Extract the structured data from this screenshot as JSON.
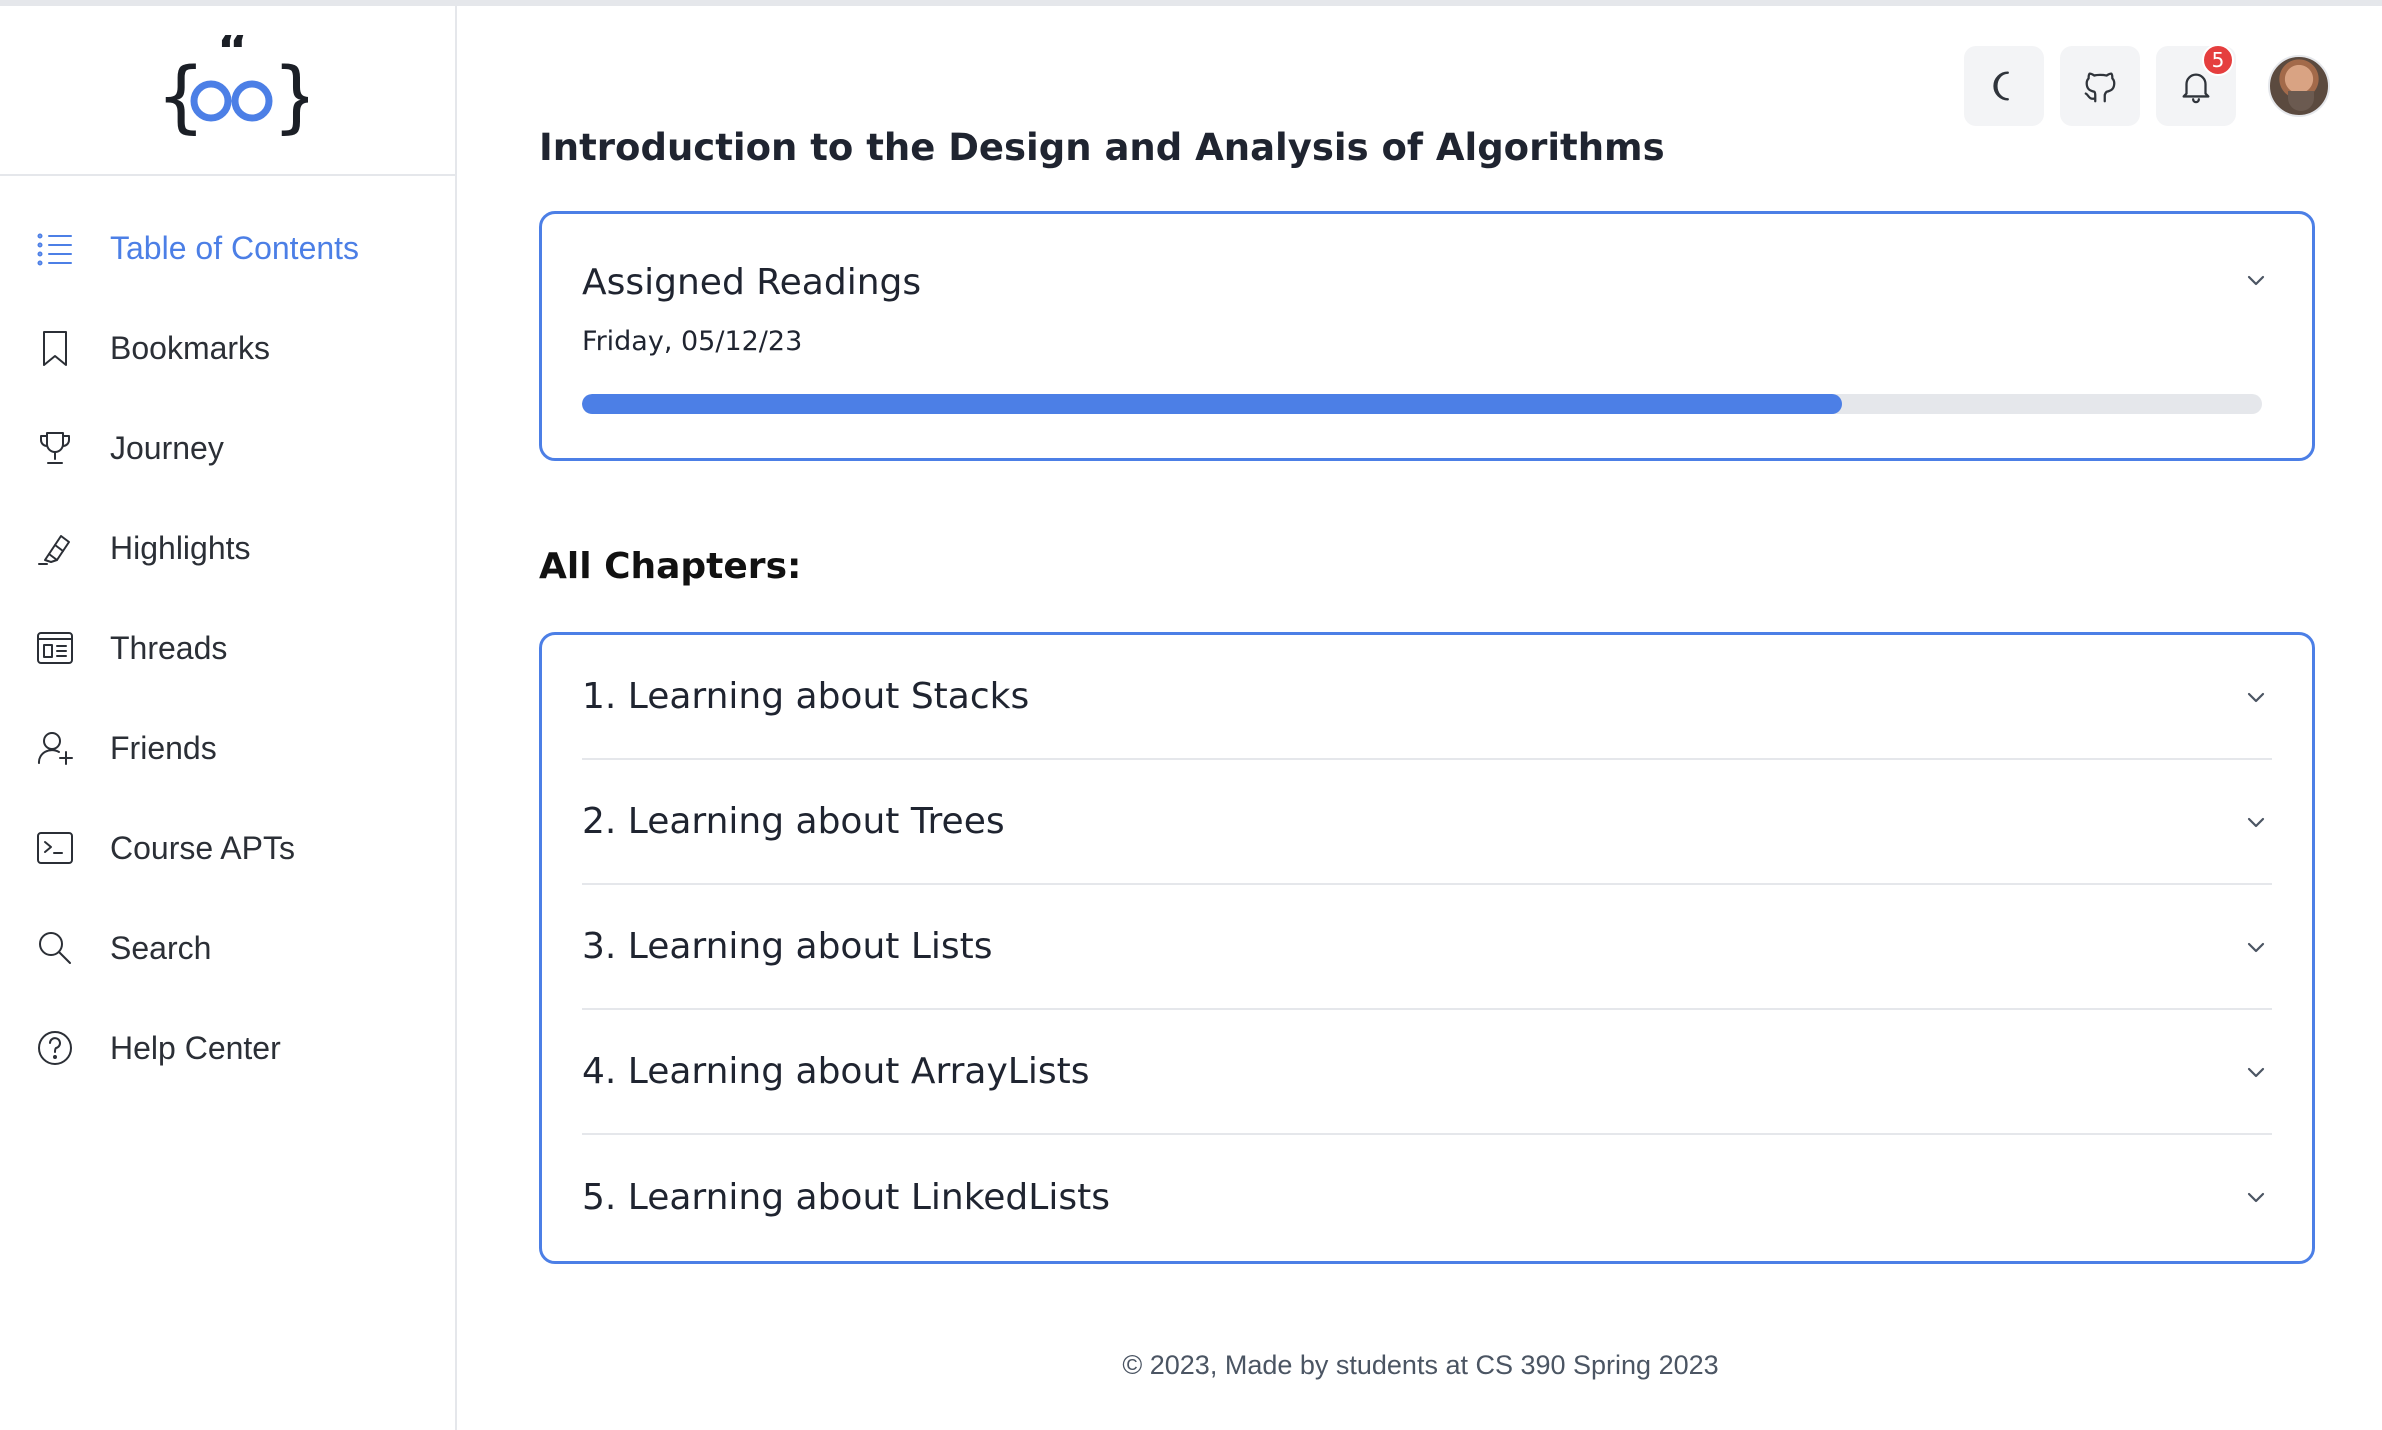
{
  "sidebar": {
    "items": [
      {
        "label": "Table of Contents",
        "icon": "list-icon",
        "active": true
      },
      {
        "label": "Bookmarks",
        "icon": "bookmark-icon"
      },
      {
        "label": "Journey",
        "icon": "trophy-icon"
      },
      {
        "label": "Highlights",
        "icon": "highlighter-icon"
      },
      {
        "label": "Threads",
        "icon": "threads-icon"
      },
      {
        "label": "Friends",
        "icon": "add-friend-icon"
      },
      {
        "label": "Course APTs",
        "icon": "terminal-icon"
      },
      {
        "label": "Search",
        "icon": "search-icon"
      },
      {
        "label": "Help Center",
        "icon": "help-icon"
      }
    ]
  },
  "header": {
    "notifications_count": "5",
    "icons": [
      "moon-icon",
      "github-icon",
      "bell-icon",
      "avatar"
    ]
  },
  "main": {
    "title": "Introduction to the Design and Analysis of Algorithms",
    "readings": {
      "title": "Assigned Readings",
      "date": "Friday, 05/12/23",
      "progress": 0.75
    },
    "chapters_heading": "All Chapters:",
    "chapters": [
      {
        "label": "1. Learning about Stacks"
      },
      {
        "label": "2. Learning about Trees"
      },
      {
        "label": "3. Learning about Lists"
      },
      {
        "label": "4. Learning about ArrayLists"
      },
      {
        "label": "5. Learning about LinkedLists"
      }
    ]
  },
  "footer": {
    "text": "© 2023, Made by students at CS 390 Spring 2023"
  },
  "colors": {
    "accent": "#4c7fe6",
    "badge": "#e53e3e",
    "border": "#e5e7eb"
  }
}
